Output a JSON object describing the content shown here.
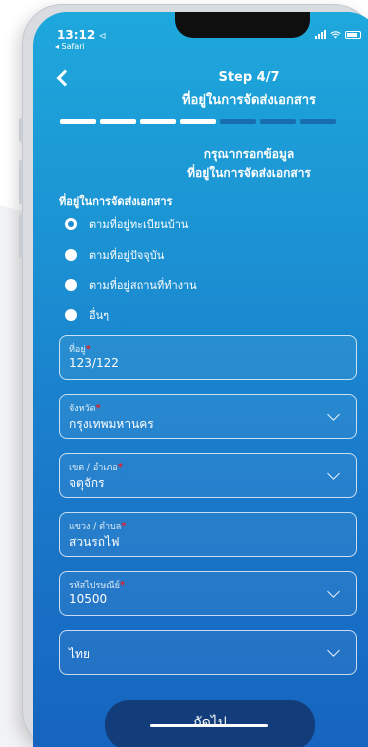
{
  "status_bar": {
    "time": "13:12 ◃",
    "back_app": "◂ Safari"
  },
  "header": {
    "step": "Step 4/7",
    "title": "ที่อยู่ในการจัดส่งเอกสาร",
    "progress": {
      "current": 4,
      "total": 7
    }
  },
  "form": {
    "heading_line1": "กรุณากรอกข้อมูล",
    "heading_line2": "ที่อยู่ในการจัดส่งเอกสาร",
    "section_label": "ที่อยู่ในการจัดส่งเอกสาร",
    "options": [
      {
        "label": "ตามที่อยู่ทะเบียนบ้าน",
        "selected": true
      },
      {
        "label": "ตามที่อยู่ปัจจุบัน",
        "selected": false
      },
      {
        "label": "ตามที่อยู่สถานที่ทำงาน",
        "selected": false
      },
      {
        "label": "อื่นๆ",
        "selected": false
      }
    ],
    "fields": [
      {
        "label": "ที่อยู่",
        "required": "*",
        "value": "123/122",
        "dropdown": false
      },
      {
        "label": "จังหวัด",
        "required": "*",
        "value": "กรุงเทพมหานคร",
        "dropdown": true
      },
      {
        "label": "เขต / อำเภอ",
        "required": "*",
        "value": "จตุจักร",
        "dropdown": true
      },
      {
        "label": "แขวง / ตำบล",
        "required": "*",
        "value": "สวนรถไฟ",
        "dropdown": false
      },
      {
        "label": "รหัสไปรษณีย์",
        "required": "*",
        "value": "10500",
        "dropdown": true
      },
      {
        "label": "",
        "required": "",
        "value": "ไทย",
        "dropdown": true
      }
    ],
    "next_label": "ถัดไป"
  },
  "colors": {
    "gradient_top": "#1ea8dc",
    "gradient_bottom": "#1664bf",
    "button": "#133d7a",
    "required_mark": "#e21e2e"
  }
}
